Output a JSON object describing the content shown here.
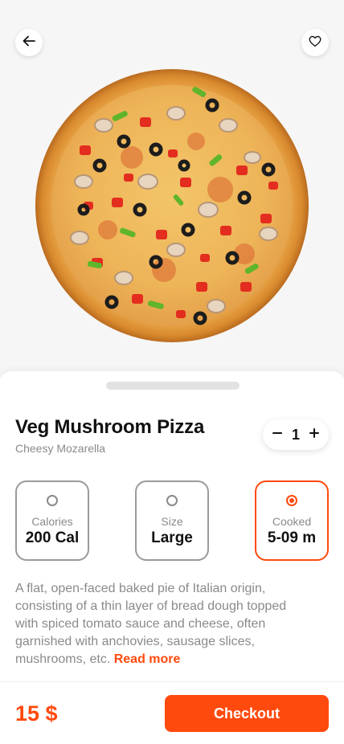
{
  "colors": {
    "accent": "#ff4a0e",
    "muted_text": "#8a8a8a",
    "hero_bg": "#f6f6f6"
  },
  "header": {
    "back_icon": "arrow-left-icon",
    "favorite_icon": "heart-icon"
  },
  "product": {
    "title": "Veg Mushroom Pizza",
    "subtitle": "Cheesy Mozarella",
    "image": "pizza-image"
  },
  "stepper": {
    "minus": "−",
    "quantity": "1",
    "plus": "+"
  },
  "options": [
    {
      "label": "Calories",
      "value": "200 Cal",
      "selected": false
    },
    {
      "label": "Size",
      "value": "Large",
      "selected": false
    },
    {
      "label": "Cooked",
      "value": "5-09 m",
      "selected": true
    }
  ],
  "description": {
    "text": "A flat, open-faced baked pie of Italian origin, consisting of a thin layer of bread dough topped with spiced tomato sauce and cheese, often garnished with anchovies, sausage slices, mushrooms, etc.",
    "read_more": "Read more"
  },
  "footer": {
    "price": "15 $",
    "checkout_label": "Checkout"
  }
}
